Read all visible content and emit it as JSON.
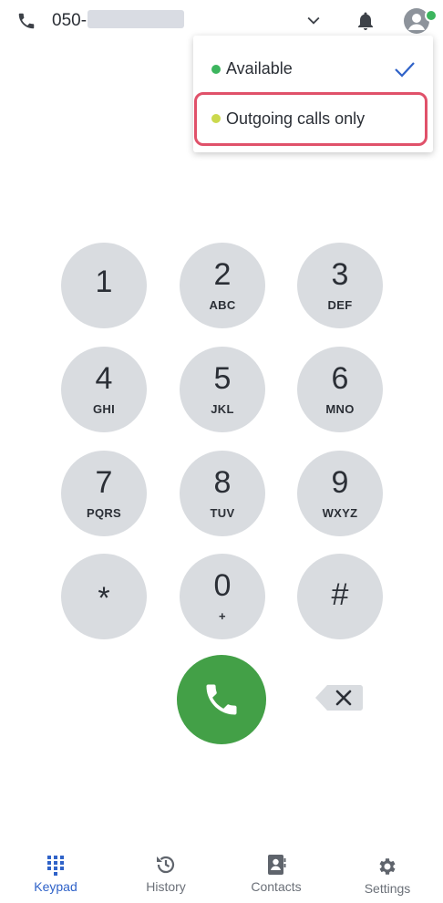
{
  "header": {
    "phone_number_prefix": "050-",
    "icons": [
      "phone-icon",
      "chevron-down-icon",
      "bell-icon",
      "avatar-icon"
    ]
  },
  "status_menu": {
    "items": [
      {
        "label": "Available",
        "status_color": "#3cb55e",
        "selected": true
      },
      {
        "label": "Outgoing calls only",
        "status_color": "#cbd94d",
        "selected": false
      }
    ]
  },
  "keypad": {
    "keys": [
      {
        "digit": "1",
        "letters": ""
      },
      {
        "digit": "2",
        "letters": "ABC"
      },
      {
        "digit": "3",
        "letters": "DEF"
      },
      {
        "digit": "4",
        "letters": "GHI"
      },
      {
        "digit": "5",
        "letters": "JKL"
      },
      {
        "digit": "6",
        "letters": "MNO"
      },
      {
        "digit": "7",
        "letters": "PQRS"
      },
      {
        "digit": "8",
        "letters": "TUV"
      },
      {
        "digit": "9",
        "letters": "WXYZ"
      },
      {
        "digit": "*",
        "letters": ""
      },
      {
        "digit": "0",
        "letters": "+"
      },
      {
        "digit": "#",
        "letters": ""
      }
    ]
  },
  "nav": {
    "items": [
      {
        "label": "Keypad",
        "icon": "keypad-icon",
        "active": true
      },
      {
        "label": "History",
        "icon": "history-icon",
        "active": false
      },
      {
        "label": "Contacts",
        "icon": "contacts-icon",
        "active": false
      },
      {
        "label": "Settings",
        "icon": "gear-icon",
        "active": false
      }
    ]
  },
  "colors": {
    "accent": "#2f62c8",
    "call_green": "#43a047",
    "key_bg": "#d9dce0",
    "highlight": "#e0516a"
  }
}
